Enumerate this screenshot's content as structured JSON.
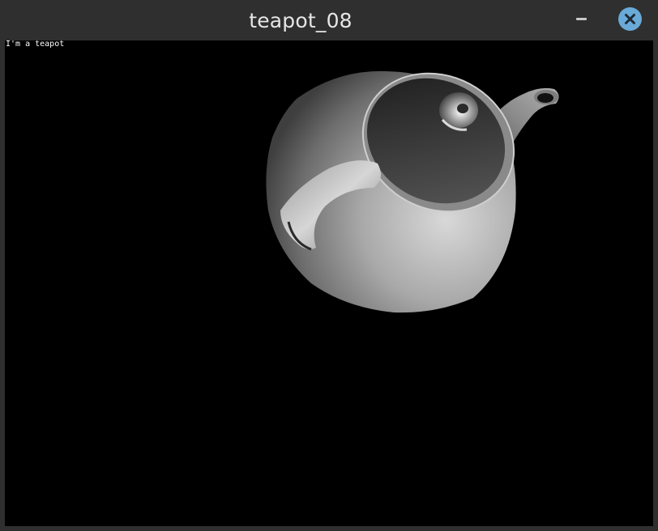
{
  "window": {
    "title": "teapot_08"
  },
  "titlebar": {
    "minimize_icon": "minimize-icon",
    "close_icon": "close-icon",
    "close_color": "#6aaad8"
  },
  "canvas": {
    "overlay_text": "I'm a teapot",
    "background": "#000000"
  }
}
